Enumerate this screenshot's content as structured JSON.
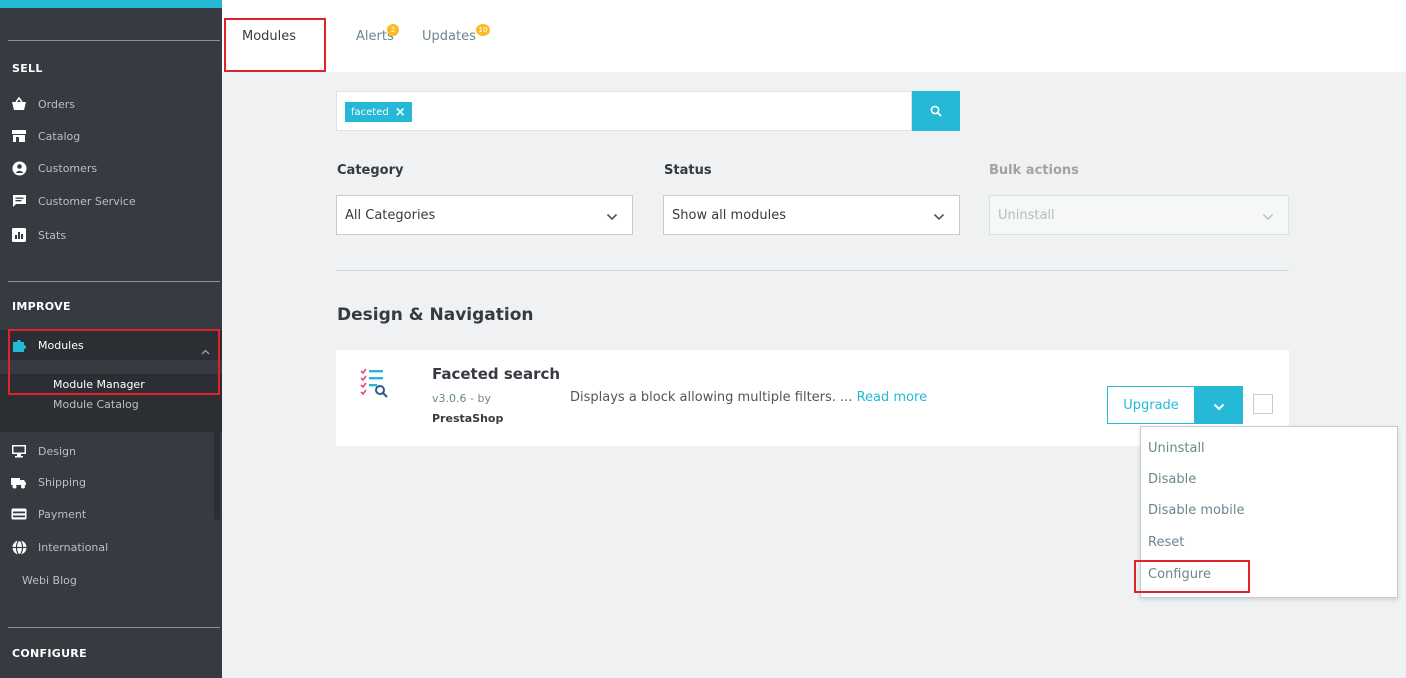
{
  "sidebar": {
    "sell_heading": "SELL",
    "sell_items": [
      {
        "label": "Orders",
        "icon": "basket-icon"
      },
      {
        "label": "Catalog",
        "icon": "store-icon"
      },
      {
        "label": "Customers",
        "icon": "account-circle-icon"
      },
      {
        "label": "Customer Service",
        "icon": "chat-icon"
      },
      {
        "label": "Stats",
        "icon": "bar-chart-icon"
      }
    ],
    "improve_heading": "IMPROVE",
    "modules": {
      "label": "Modules",
      "icon": "puzzle-icon",
      "sub_items": [
        "Module Manager",
        "Module Catalog"
      ]
    },
    "improve_items": [
      {
        "label": "Design",
        "icon": "desktop-icon"
      },
      {
        "label": "Shipping",
        "icon": "truck-icon"
      },
      {
        "label": "Payment",
        "icon": "credit-card-icon"
      },
      {
        "label": "International",
        "icon": "globe-icon"
      }
    ],
    "extra_item": "Webi Blog",
    "configure_heading": "CONFIGURE"
  },
  "tabs": [
    {
      "label": "Modules",
      "badge": ""
    },
    {
      "label": "Alerts",
      "badge": "2"
    },
    {
      "label": "Updates",
      "badge": "10"
    }
  ],
  "search": {
    "tag": "faceted"
  },
  "filters": {
    "category": {
      "label": "Category",
      "value": "All Categories"
    },
    "status": {
      "label": "Status",
      "value": "Show all modules"
    },
    "bulk": {
      "label": "Bulk actions",
      "value": "Uninstall"
    }
  },
  "section": {
    "title": "Design & Navigation"
  },
  "module": {
    "name": "Faceted search",
    "version": "v3.0.6 - by",
    "author": "PrestaShop",
    "description": "Displays a block allowing multiple filters. ...",
    "read_more": "Read more",
    "upgrade_label": "Upgrade"
  },
  "dropdown_menu": [
    "Uninstall",
    "Disable",
    "Disable mobile",
    "Reset",
    "Configure"
  ],
  "colors": {
    "accent": "#25b9d7",
    "sidebar_bg": "#363a41",
    "highlight_box": "#e0232b",
    "badge": "#fbbb22"
  }
}
